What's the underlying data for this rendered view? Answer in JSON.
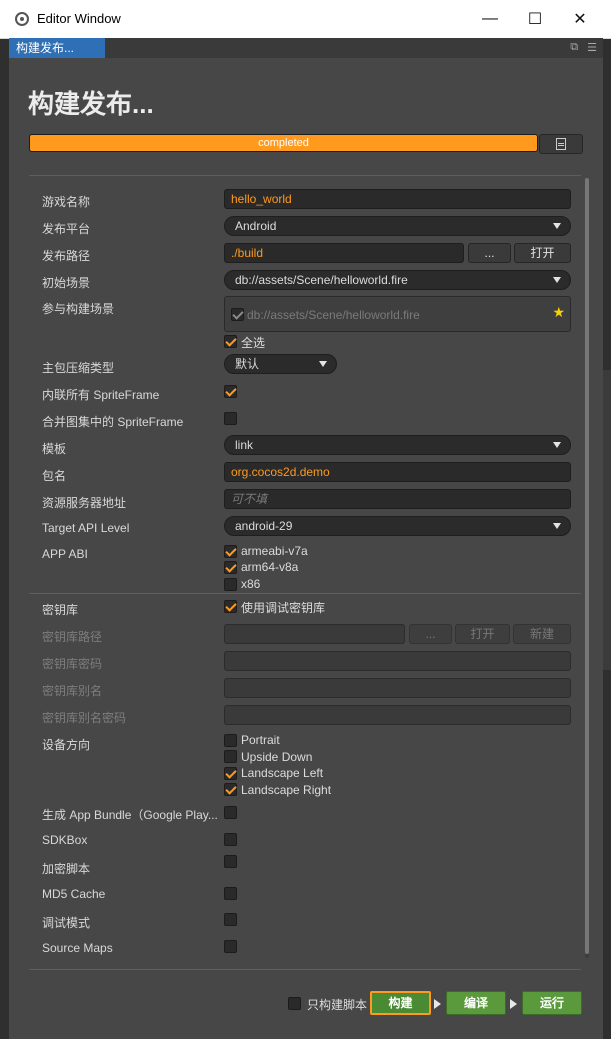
{
  "window": {
    "title": "Editor Window",
    "min_glyph": "—",
    "max_glyph": "☐",
    "close_glyph": "✕"
  },
  "tab": {
    "label": "构建发布..."
  },
  "heading": "构建发布...",
  "progress": {
    "text": "completed",
    "percent": 100,
    "color": "#ff9a1f"
  },
  "form": {
    "game_name": {
      "label": "游戏名称",
      "value": "hello_world"
    },
    "platform": {
      "label": "发布平台",
      "value": "Android"
    },
    "build_path": {
      "label": "发布路径",
      "value": "./build",
      "browse": "...",
      "open": "打开"
    },
    "start_scene": {
      "label": "初始场景",
      "value": "db://assets/Scene/helloworld.fire"
    },
    "included_scenes": {
      "label": "参与构建场景",
      "scene": "db://assets/Scene/helloworld.fire",
      "select_all": "全选"
    },
    "compression": {
      "label": "主包压缩类型",
      "value": "默认"
    },
    "inline_spriteframe": {
      "label": "内联所有 SpriteFrame",
      "checked": true
    },
    "merge_spriteframe": {
      "label": "合并图集中的 SpriteFrame",
      "checked": false
    },
    "template": {
      "label": "模板",
      "value": "link"
    },
    "package_name": {
      "label": "包名",
      "value": "org.cocos2d.demo"
    },
    "resource_server": {
      "label": "资源服务器地址",
      "placeholder": "可不填"
    },
    "target_api": {
      "label": "Target API Level",
      "value": "android-29"
    },
    "app_abi": {
      "label": "APP ABI",
      "options": [
        {
          "name": "armeabi-v7a",
          "checked": true
        },
        {
          "name": "arm64-v8a",
          "checked": true
        },
        {
          "name": "x86",
          "checked": false
        }
      ]
    },
    "keystore": {
      "label": "密钥库",
      "option": "使用调试密钥库",
      "checked": true
    },
    "keystore_path": {
      "label": "密钥库路径",
      "browse": "...",
      "open": "打开",
      "create": "新建"
    },
    "keystore_password": {
      "label": "密钥库密码"
    },
    "keystore_alias": {
      "label": "密钥库别名"
    },
    "keystore_alias_password": {
      "label": "密钥库别名密码"
    },
    "orientation": {
      "label": "设备方向",
      "options": [
        {
          "name": "Portrait",
          "checked": false
        },
        {
          "name": "Upside Down",
          "checked": false
        },
        {
          "name": "Landscape Left",
          "checked": true
        },
        {
          "name": "Landscape Right",
          "checked": true
        }
      ]
    },
    "app_bundle": {
      "label": "生成 App Bundle（Google Play...",
      "checked": false
    },
    "sdkbox": {
      "label": "SDKBox",
      "checked": false
    },
    "encrypt_scripts": {
      "label": "加密脚本",
      "checked": false
    },
    "md5_cache": {
      "label": "MD5 Cache",
      "checked": false
    },
    "debug_mode": {
      "label": "调试模式",
      "checked": false
    },
    "source_maps": {
      "label": "Source Maps",
      "checked": false
    }
  },
  "footer": {
    "build_scripts_only": {
      "label": "只构建脚本",
      "checked": false
    },
    "build": "构建",
    "compile": "编译",
    "run": "运行"
  }
}
